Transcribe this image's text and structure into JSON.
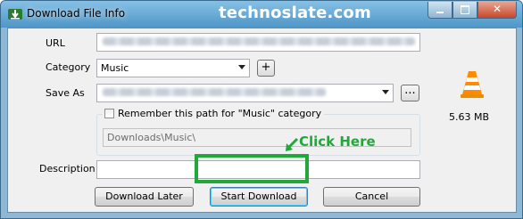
{
  "window": {
    "title": "Download File Info"
  },
  "watermark": "technoslate.com",
  "form": {
    "url_label": "URL",
    "category_label": "Category",
    "category_value": "Music",
    "add_category_label": "+",
    "save_as_label": "Save As",
    "browse_label": "...",
    "remember_label": "Remember this path for \"Music\" category",
    "path_value": "Downloads\\Music\\",
    "description_label": "Description",
    "description_value": ""
  },
  "file_size": "5.63 MB",
  "buttons": {
    "download_later": "Download Later",
    "start_download": "Start Download",
    "cancel": "Cancel"
  },
  "annotation": {
    "click_here": "Click Here"
  },
  "colors": {
    "accent_green": "#22a83a",
    "title_bar": "#5fa3cf"
  },
  "icons": [
    "idm-app-icon",
    "vlc-cone-icon",
    "chevron-down-icon",
    "green-arrow-icon"
  ]
}
